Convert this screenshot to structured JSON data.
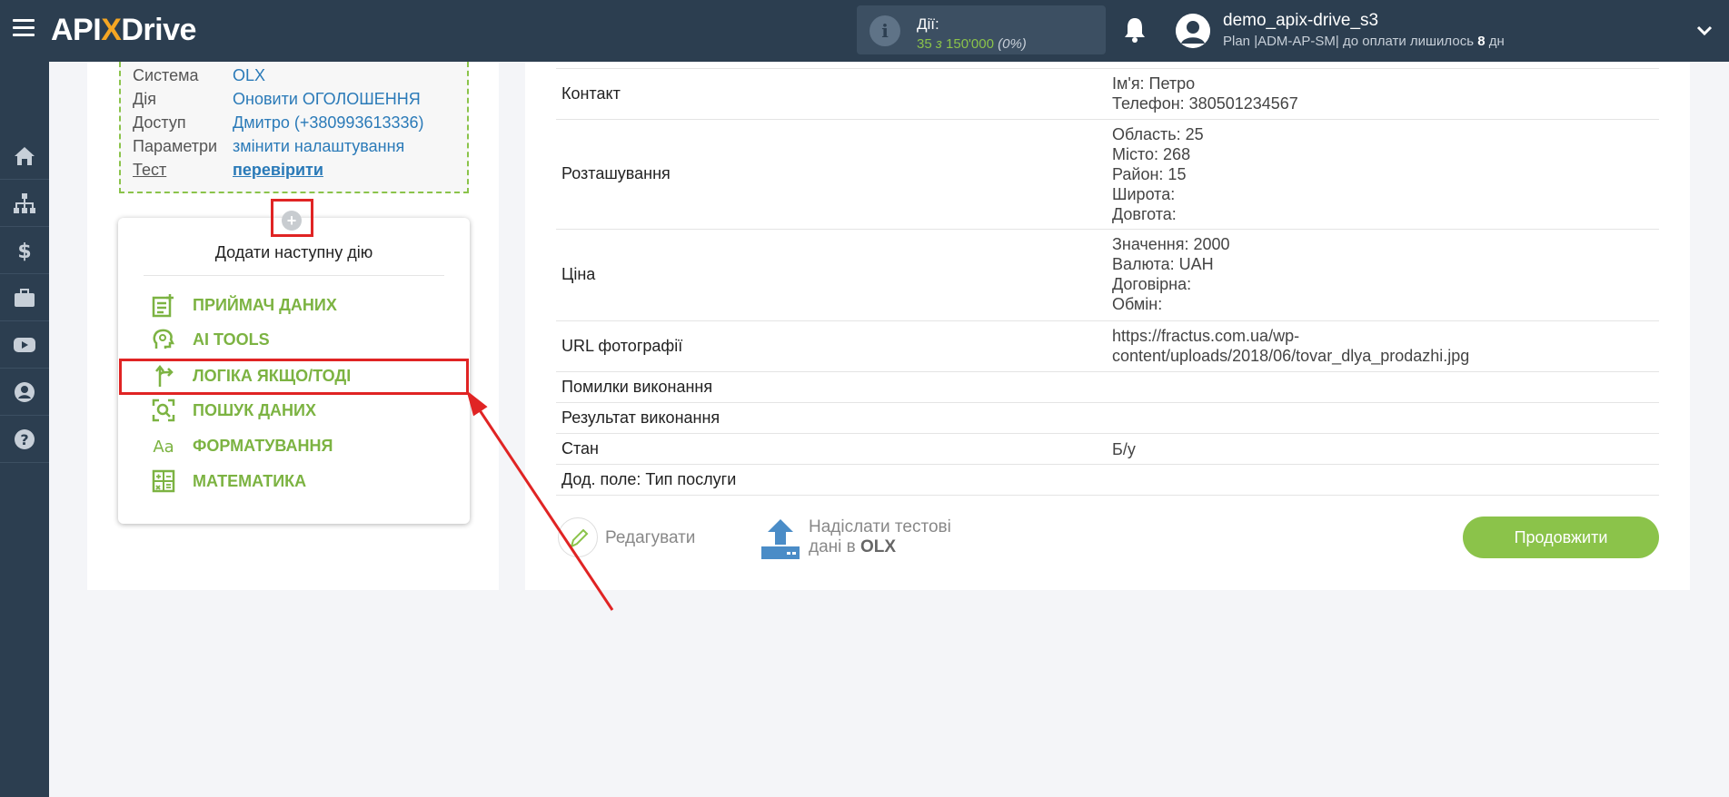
{
  "header": {
    "logo_main": "API",
    "logo_x": "X",
    "logo_tail": "Drive",
    "actions_label": "Дії:",
    "actions_used": "35",
    "actions_sep": "з",
    "actions_total": "150'000",
    "actions_pct": "(0%)",
    "user_name": "demo_apix-drive_s3",
    "plan_text": "Plan |ADM-AP-SM| до оплати лишилось",
    "plan_days": "8",
    "plan_days_unit": "дн"
  },
  "sidebar": {
    "items": [
      "home-icon",
      "sitemap-icon",
      "dollar-icon",
      "briefcase-icon",
      "youtube-icon",
      "user-icon",
      "help-icon"
    ]
  },
  "connection": {
    "rows": [
      {
        "key": "Система",
        "value": "OLX"
      },
      {
        "key": "Дія",
        "value": "Оновити ОГОЛОШЕННЯ"
      },
      {
        "key": "Доступ",
        "value": "Дмитро (+380993613336)"
      },
      {
        "key": "Параметри",
        "value": "змінити налаштування"
      },
      {
        "key": "Тест",
        "value": "перевірити"
      }
    ]
  },
  "add_action": {
    "plus": "+",
    "title": "Додати наступну дію",
    "items": [
      {
        "label": "ПРИЙМАЧ ДАНИХ",
        "icon": "receiver-icon"
      },
      {
        "label": "AI TOOLS",
        "icon": "ai-head-icon"
      },
      {
        "label": "ЛОГІКА ЯКЩО/ТОДІ",
        "icon": "branch-arrow-icon"
      },
      {
        "label": "ПОШУК ДАНИХ",
        "icon": "search-data-icon"
      },
      {
        "label": "ФОРМАТУВАННЯ",
        "icon": "format-icon"
      },
      {
        "label": "МАТЕМАТИКА",
        "icon": "calculator-icon"
      }
    ]
  },
  "data_rows": [
    {
      "key": "Контакт",
      "value": [
        "Ім'я: Петро",
        "Телефон: 380501234567"
      ]
    },
    {
      "key": "Розташування",
      "value": [
        "Область: 25",
        "Місто: 268",
        "Район: 15",
        "Широта:",
        "Довгота:"
      ]
    },
    {
      "key": "Ціна",
      "value": [
        "Значення: 2000",
        "Валюта: UAH",
        "Договірна:",
        "Обмін:"
      ]
    },
    {
      "key": "URL фотографії",
      "value": [
        "https://fractus.com.ua/wp-",
        "content/uploads/2018/06/tovar_dlya_prodazhi.jpg"
      ]
    },
    {
      "key": "Помилки виконання",
      "value": []
    },
    {
      "key": "Результат виконання",
      "value": []
    },
    {
      "key": "Стан",
      "value": [
        "Б/у"
      ]
    },
    {
      "key": "Дод. поле: Тип послуги",
      "value": []
    }
  ],
  "buttons": {
    "edit": "Редагувати",
    "send_line1": "Надіслати тестові",
    "send_line2_prefix": "дані в",
    "send_line2_target": "OLX",
    "continue": "Продовжити"
  },
  "colors": {
    "header_bg": "#2c3e50",
    "accent_green": "#8bc34a",
    "link_blue": "#2a7ab8",
    "highlight_red": "#e02424",
    "logo_orange": "#f5a623"
  }
}
